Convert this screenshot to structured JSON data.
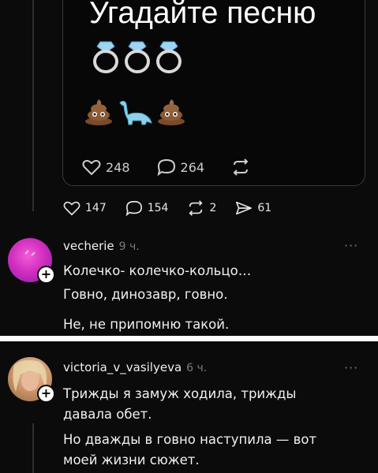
{
  "card": {
    "title": "Угадайте песню",
    "emoji_top": [
      "ring-icon",
      "ring-icon",
      "ring-icon"
    ],
    "emoji_bottom": [
      "poop-icon",
      "dinosaur-icon",
      "poop-icon"
    ],
    "stats": [
      {
        "icon": "heart-icon",
        "value": "248"
      },
      {
        "icon": "comment-icon",
        "value": "264"
      },
      {
        "icon": "repost-icon",
        "value": ""
      }
    ]
  },
  "post_stats": [
    {
      "icon": "heart-icon",
      "value": "147"
    },
    {
      "icon": "comment-icon",
      "value": "154"
    },
    {
      "icon": "repost-icon",
      "value": "2"
    },
    {
      "icon": "share-icon",
      "value": "61"
    }
  ],
  "replies": [
    {
      "username": "vecherie",
      "time": "9 ч.",
      "more": "···",
      "lines": [
        "Колечко- колечко-кольцо…",
        "Говно, динозавр, говно."
      ],
      "extra": "Не, не припомню такой."
    },
    {
      "username": "victoria_v_vasilyeva",
      "time": "6 ч.",
      "more": "···",
      "lines": [
        "Трижды я замуж ходила, трижды",
        "давала обет.",
        "Но дважды в говно наступила — вот",
        "моей жизни сюжет."
      ]
    }
  ],
  "colors": {
    "background": "#0b0b0b",
    "text": "#f1f1f1",
    "muted": "#7a7a7a"
  }
}
